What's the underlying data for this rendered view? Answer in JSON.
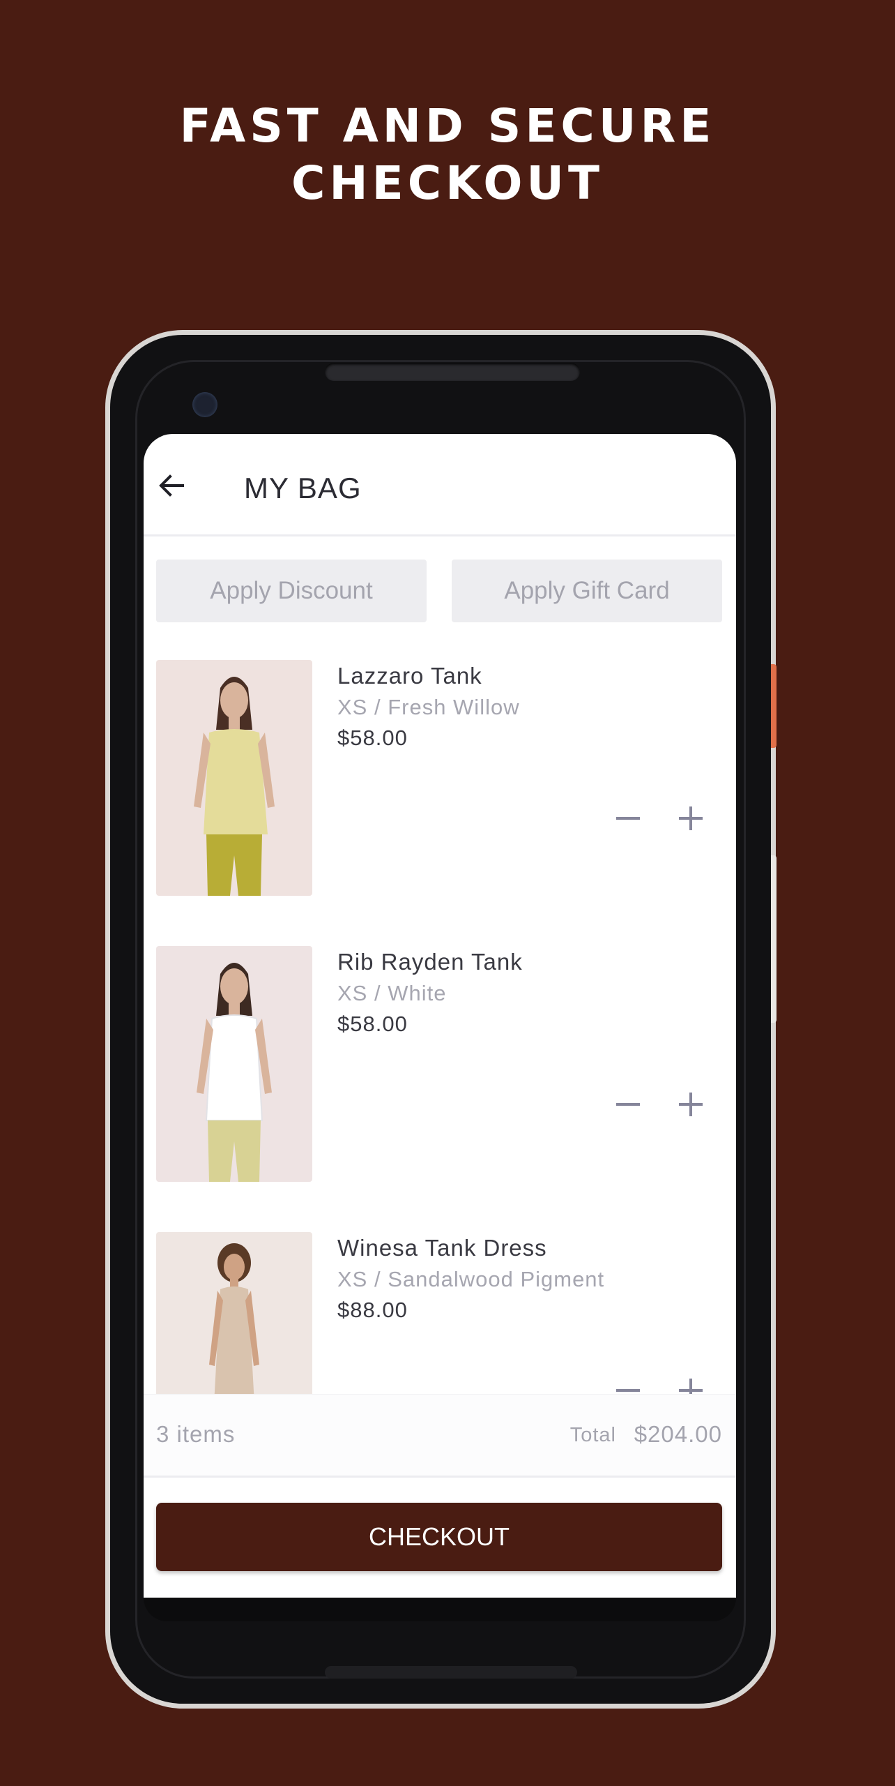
{
  "promo": {
    "headline_line1": "FAST AND SECURE",
    "headline_line2": "CHECKOUT"
  },
  "appbar": {
    "title": "MY BAG",
    "back_icon": "arrow-left-icon"
  },
  "actions": {
    "discount_label": "Apply Discount",
    "gift_card_label": "Apply Gift Card"
  },
  "items": [
    {
      "name": "Lazzaro Tank",
      "variant": "XS / Fresh Willow",
      "price": "$58.00"
    },
    {
      "name": "Rib Rayden Tank",
      "variant": "XS / White",
      "price": "$58.00"
    },
    {
      "name": "Winesa Tank Dress",
      "variant": "XS / Sandalwood Pigment",
      "price": "$88.00"
    }
  ],
  "summary": {
    "count": "3 items",
    "total_label": "Total",
    "total_value": "$204.00"
  },
  "checkout": {
    "label": "CHECKOUT"
  },
  "colors": {
    "brand": "#4a1c12",
    "screen_bg": "#ffffff",
    "muted_text": "#a4a4ae"
  },
  "icons": {
    "decrease": "minus-icon",
    "increase": "plus-icon"
  }
}
